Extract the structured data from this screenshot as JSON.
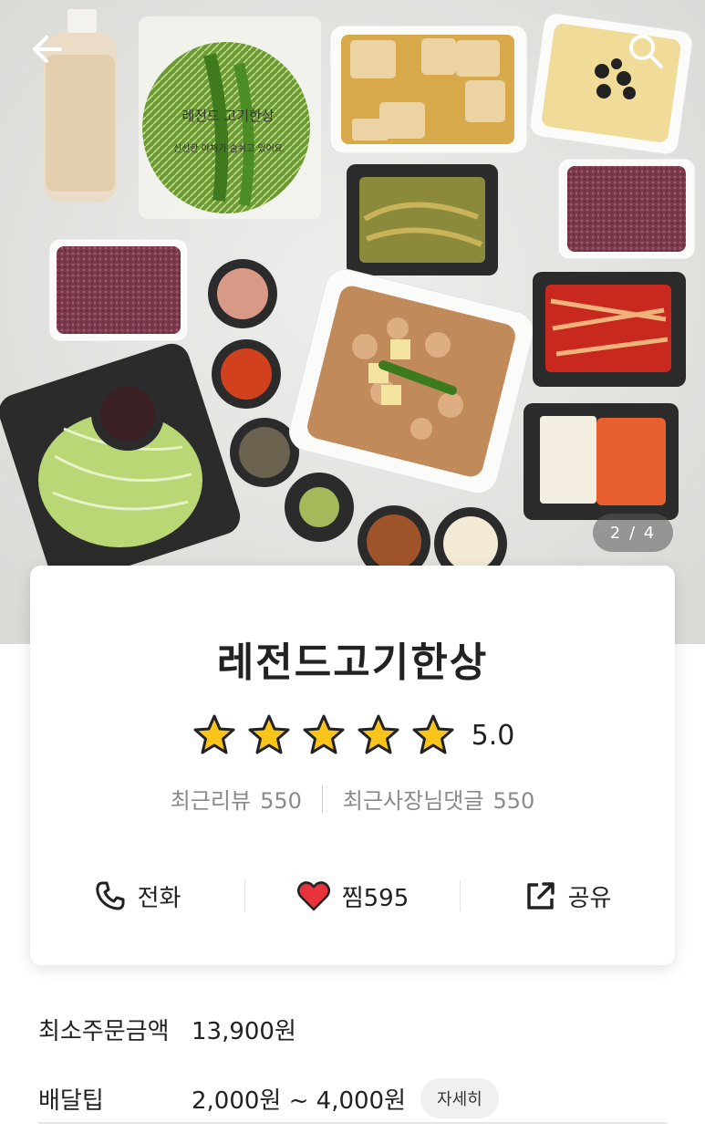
{
  "header": {
    "back_icon": "arrow-left-icon",
    "search_icon": "search-icon",
    "pager_text": "2 / 4",
    "bag_label": "레전드 고기한상",
    "bag_tagline": "신선한 야채가 숨쉬고 있어요"
  },
  "store": {
    "name": "레전드고기한상",
    "rating": 5.0,
    "rating_text": "5.0",
    "stars_filled": 5,
    "star_color": "#F9C51B",
    "recent_review_label": "최근리뷰",
    "recent_review_count": "550",
    "owner_reply_label": "최근사장님댓글",
    "owner_reply_count": "550"
  },
  "actions": {
    "call_label": "전화",
    "like_label": "찜",
    "like_count": "595",
    "share_label": "공유",
    "heart_color": "#E8323C"
  },
  "info": {
    "min_order_label": "최소주문금액",
    "min_order_value": "13,900원",
    "delivery_tip_label": "배달팁",
    "delivery_tip_value": "2,000원 ~ 4,000원",
    "detail_button": "자세히"
  }
}
